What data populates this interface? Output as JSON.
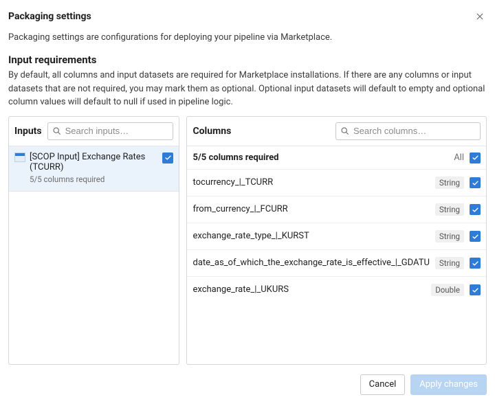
{
  "dialog": {
    "title": "Packaging settings",
    "description": "Packaging settings are configurations for deploying your pipeline via Marketplace.",
    "section_title": "Input requirements",
    "section_description": "By default, all columns and input datasets are required for Marketplace installations. If there are any columns or input datasets that are not required, you may mark them as optional. Optional input datasets will default to empty and optional column values will default to null if used in pipeline logic."
  },
  "inputs_panel": {
    "title": "Inputs",
    "search_placeholder": "Search inputs…",
    "items": [
      {
        "name": "[SCOP Input] Exchange Rates (TCURR)",
        "subtitle": "5/5 columns required",
        "checked": true
      }
    ]
  },
  "columns_panel": {
    "title": "Columns",
    "search_placeholder": "Search columns…",
    "summary": "5/5 columns required",
    "all_label": "All",
    "all_checked": true,
    "columns": [
      {
        "name": "tocurrency_|_TCURR",
        "type": "String",
        "checked": true
      },
      {
        "name": "from_currency_|_FCURR",
        "type": "String",
        "checked": true
      },
      {
        "name": "exchange_rate_type_|_KURST",
        "type": "String",
        "checked": true
      },
      {
        "name": "date_as_of_which_the_exchange_rate_is_effective_|_GDATU",
        "type": "String",
        "checked": true
      },
      {
        "name": "exchange_rate_|_UKURS",
        "type": "Double",
        "checked": true
      }
    ]
  },
  "footer": {
    "cancel": "Cancel",
    "apply": "Apply changes"
  }
}
